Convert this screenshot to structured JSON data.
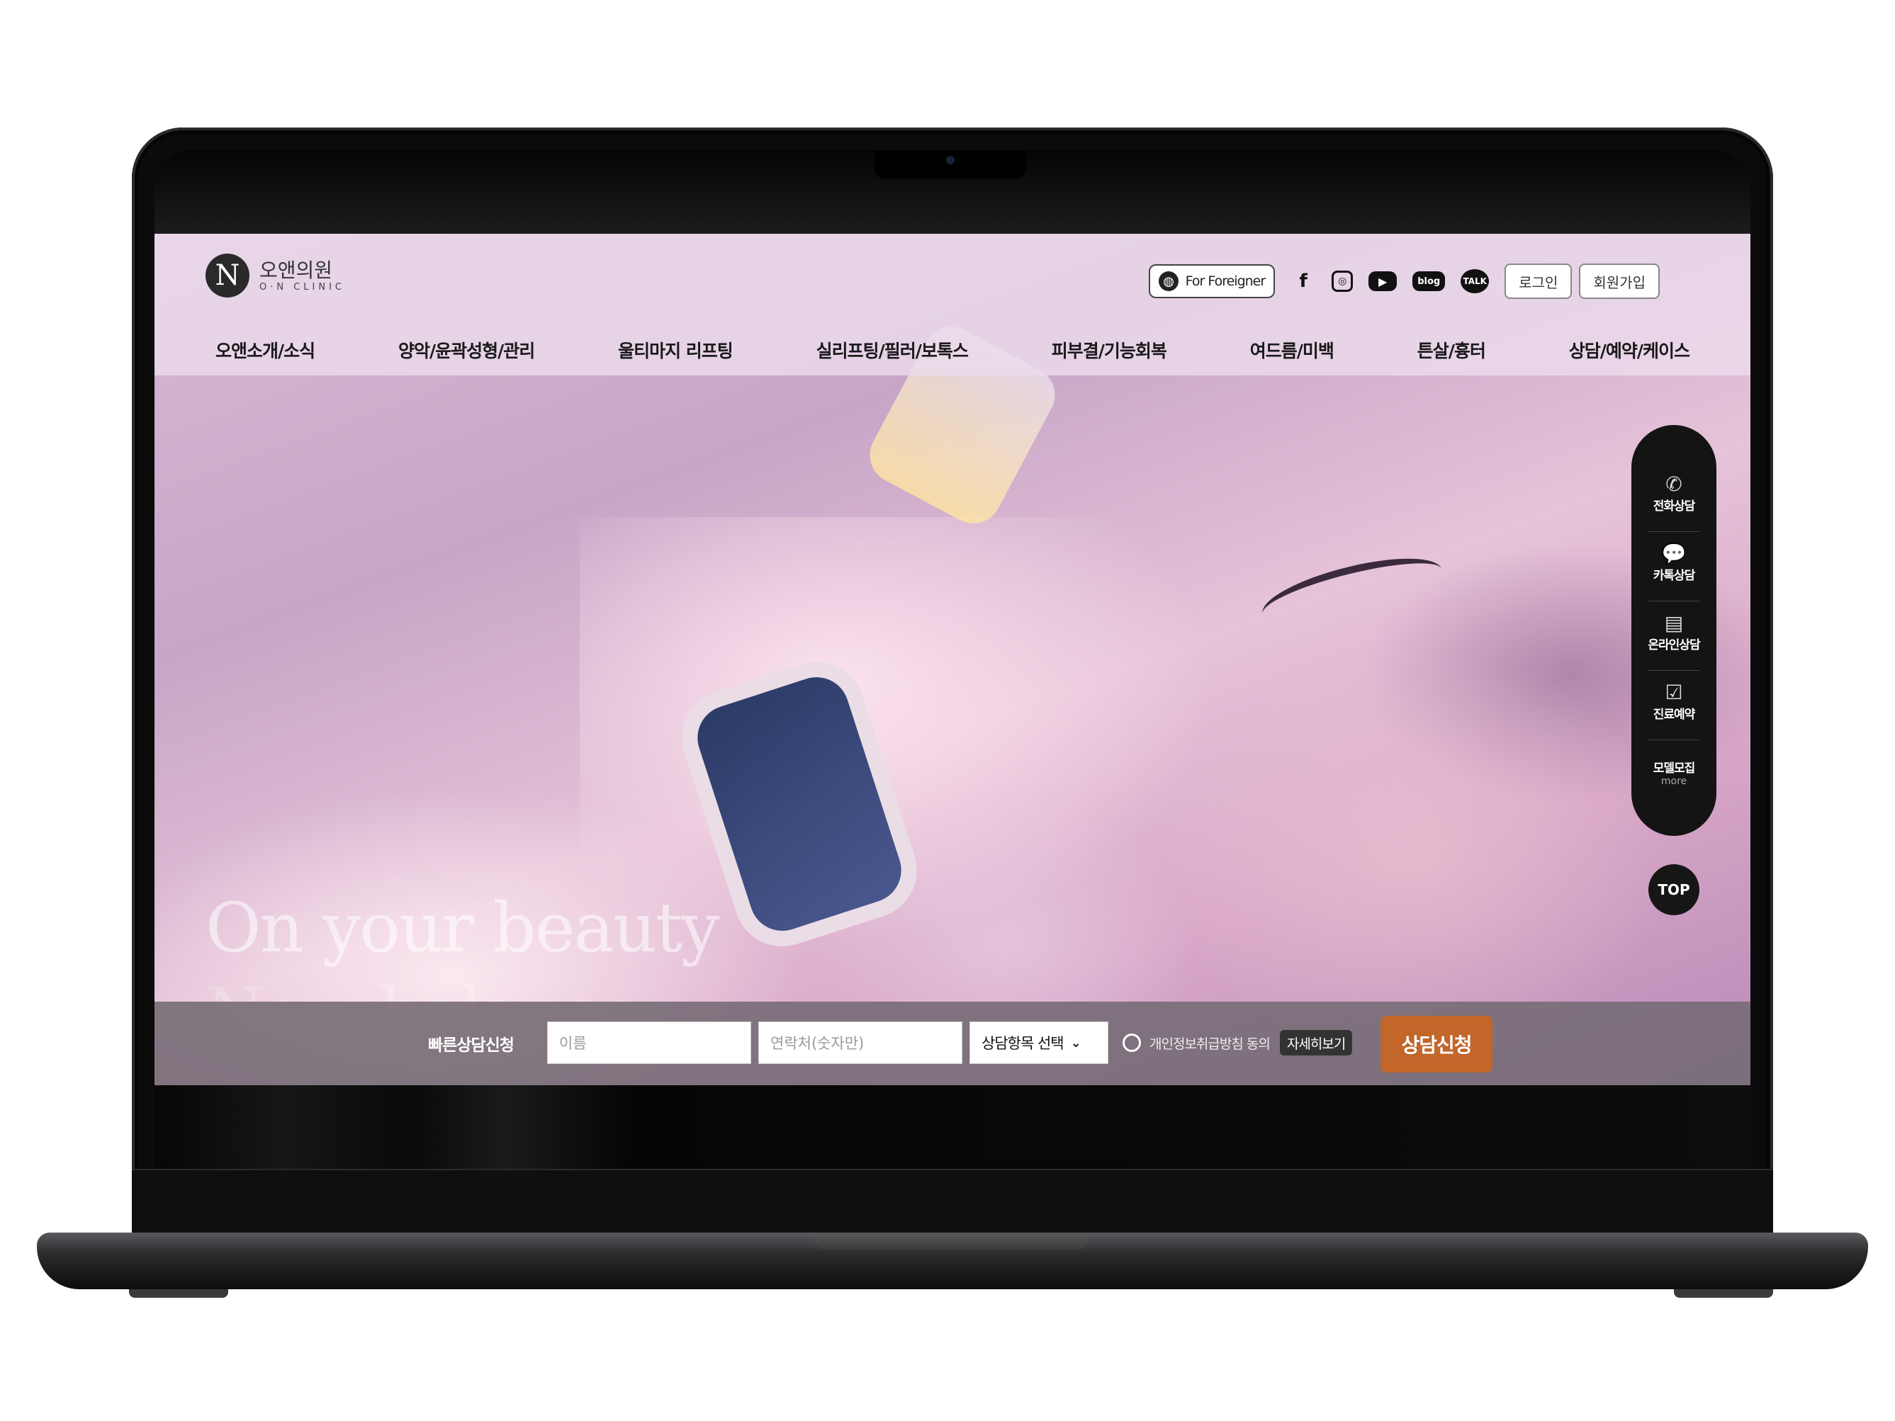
{
  "brand": {
    "logo_mark": "N",
    "name_ko": "오앤의원",
    "name_en": "O·N CLINIC"
  },
  "header": {
    "foreigner_label": "For Foreigner",
    "sns": {
      "facebook": "f",
      "instagram": "◎",
      "youtube": "▶",
      "blog": "blog",
      "talk": "TALK"
    },
    "login_label": "로그인",
    "signup_label": "회원가입"
  },
  "nav": {
    "items": [
      {
        "label": "오앤소개/소식"
      },
      {
        "label": "양악/윤곽성형/관리"
      },
      {
        "label": "울티마지 리프팅"
      },
      {
        "label": "실리프팅/필러/보톡스"
      },
      {
        "label": "피부결/기능회복"
      },
      {
        "label": "여드름/미백"
      },
      {
        "label": "튼살/흉터"
      },
      {
        "label": "상담/예약/케이스"
      }
    ]
  },
  "hero": {
    "headline": "On your beauty",
    "subline": "New balance"
  },
  "quick_menu": {
    "items": [
      {
        "icon": "phone-icon",
        "glyph": "✆",
        "label": "전화상담"
      },
      {
        "icon": "talk-bubble-icon",
        "glyph": "💬",
        "label": "카톡상담"
      },
      {
        "icon": "monitor-icon",
        "glyph": "▤",
        "label": "온라인상담"
      },
      {
        "icon": "calendar-check-icon",
        "glyph": "☑",
        "label": "진료예약"
      },
      {
        "icon": "",
        "glyph": "",
        "label": "모델모집",
        "more": "more"
      }
    ],
    "top_label": "TOP"
  },
  "consult_bar": {
    "title": "빠른상담신청",
    "name_placeholder": "이름",
    "phone_placeholder": "연락처(숫자만)",
    "select_value": "상담항목 선택",
    "agree_label": "개인정보취급방침 동의",
    "detail_label": "자세히보기",
    "submit_label": "상담신청"
  },
  "colors": {
    "submit": "#c2662a",
    "header_bg": "#ecdcec",
    "quick_bg": "#141414"
  }
}
